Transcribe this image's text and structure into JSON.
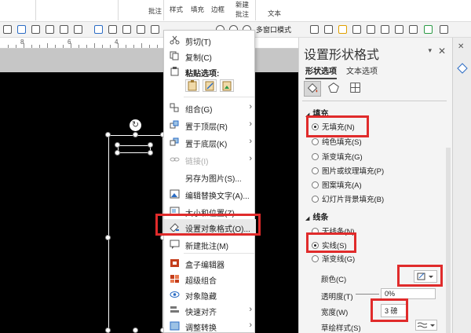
{
  "ribbon": {
    "labels": [
      "批注",
      "样式",
      "填充",
      "边框",
      "新建",
      "批注",
      "文本"
    ]
  },
  "toolbar": {
    "zoom_mode": "多窗口模式"
  },
  "ruler": {
    "numbers": [
      "8",
      "6",
      "4"
    ]
  },
  "context_menu": {
    "items": [
      {
        "label": "剪切(T)",
        "icon": "scissors-icon"
      },
      {
        "label": "复制(C)",
        "icon": "copy-icon"
      },
      {
        "label": "粘贴选项:",
        "icon": "paste-icon"
      },
      {
        "label": "组合(G)",
        "icon": "group-icon",
        "submenu": true
      },
      {
        "label": "置于顶层(R)",
        "icon": "bring-front-icon",
        "submenu": true
      },
      {
        "label": "置于底层(K)",
        "icon": "send-back-icon",
        "submenu": true
      },
      {
        "label": "链接(I)",
        "icon": "link-icon",
        "submenu": true,
        "disabled": true
      },
      {
        "label": "另存为图片(S)...",
        "icon": ""
      },
      {
        "label": "编辑替换文字(A)...",
        "icon": "alt-text-icon"
      },
      {
        "label": "大小和位置(Z)...",
        "icon": "size-icon"
      },
      {
        "label": "设置对象格式(O)...",
        "icon": "format-icon"
      },
      {
        "label": "新建批注(M)",
        "icon": "comment-icon"
      },
      {
        "label": "盒子编辑器",
        "icon": "box-editor-icon"
      },
      {
        "label": "超级组合",
        "icon": "super-group-icon"
      },
      {
        "label": "对象隐藏",
        "icon": "hide-icon"
      },
      {
        "label": "快速对齐",
        "icon": "align-icon",
        "submenu": true
      },
      {
        "label": "调整转换",
        "icon": "convert-icon",
        "submenu": true
      }
    ]
  },
  "pane": {
    "title": "设置形状格式",
    "tab_shape": "形状选项",
    "tab_text": "文本选项",
    "fill_section": "填充",
    "fill_options": [
      "无填充(N)",
      "纯色填充(S)",
      "渐变填充(G)",
      "图片或纹理填充(P)",
      "图案填充(A)",
      "幻灯片背景填充(B)"
    ],
    "line_section": "线条",
    "line_options": [
      "无线条(N)",
      "实线(S)",
      "渐变线(G)"
    ],
    "color_label": "颜色(C)",
    "transparency_label": "透明度(T)",
    "transparency_value": "0%",
    "width_label": "宽度(W)",
    "width_value": "3 磅",
    "sketch_label": "草绘样式(S)"
  },
  "colors": {
    "highlight": "#e02b2b",
    "accent": "#c43e1c"
  }
}
